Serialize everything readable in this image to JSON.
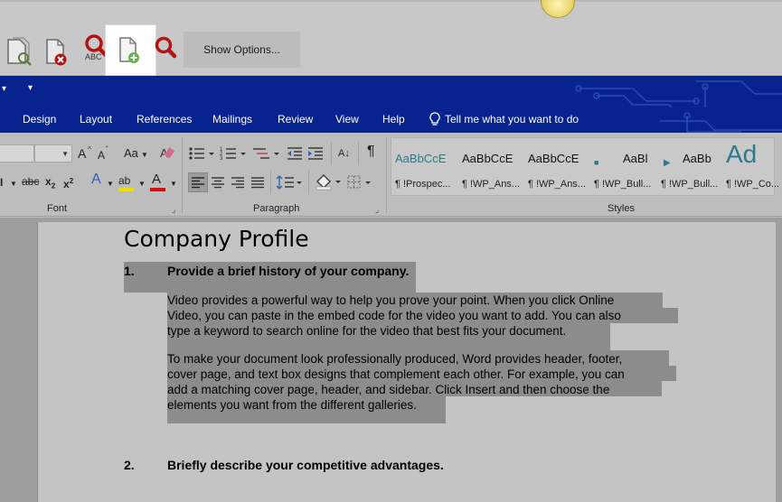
{
  "toolbar": {
    "buttons": [
      {
        "id": "document-search",
        "icon": "document-magnifier-icon"
      },
      {
        "id": "document-remove",
        "icon": "document-remove-icon"
      },
      {
        "id": "spell-search",
        "icon": "magnifier-abc-icon",
        "caption": "ABC"
      },
      {
        "id": "document-add",
        "icon": "document-add-icon",
        "active": true
      },
      {
        "id": "search",
        "icon": "magnifier-icon"
      }
    ],
    "show_options_label": "Show Options..."
  },
  "quick_access": {
    "arrow1": "▾",
    "arrow2": "▾"
  },
  "tabs": [
    "Design",
    "Layout",
    "References",
    "Mailings",
    "Review",
    "View",
    "Help"
  ],
  "tell_me": "Tell me what you want to do",
  "ribbon": {
    "font_group_label": "Font",
    "paragraph_group_label": "Paragraph",
    "styles_group_label": "Styles",
    "case_button": "Aa",
    "font_tools": {
      "grow": "A",
      "shrink": "A",
      "strike": "abc",
      "subscript": "x",
      "superscript": "x",
      "sub_index": "2",
      "sup_index": "2",
      "text_effects": "A",
      "highlight": "ab",
      "font_color": "A",
      "bold_partial": "I"
    },
    "para_tools": {
      "pilcrow": "¶",
      "sort": "A↓"
    },
    "styles": [
      {
        "sample": "AaBbCcE",
        "name": "¶ !Prospec..."
      },
      {
        "sample": "AaBbCcE",
        "name": "¶ !WP_Ans..."
      },
      {
        "sample": "AaBbCcE",
        "name": "¶ !WP_Ans..."
      },
      {
        "sample": "AaBl",
        "name": "¶ !WP_Bull..."
      },
      {
        "sample": "AaBb",
        "name": "¶ !WP_Bull..."
      },
      {
        "sample": "Ad",
        "name": "¶ !WP_Co..."
      }
    ]
  },
  "colors": {
    "accent": "#07238f",
    "highlight_gray": "#8c8c8c",
    "style_teal": "#2a7a8a",
    "icon_red": "#b01515"
  },
  "document": {
    "title": "Company Profile",
    "items": [
      {
        "number": "1.",
        "heading": "Provide a brief history of your company.",
        "paragraphs": [
          [
            "Video provides a powerful way to help you prove your point. When you click Online",
            "Video, you can paste in the embed code for the video you want to add. You can also",
            "type a keyword to search online for the video that best fits your document."
          ],
          [
            "To make your document look professionally produced, Word provides header, footer,",
            "cover page, and text box designs that complement each other. For example, you can",
            "add a matching cover page, header, and sidebar. Click Insert and then choose the",
            "elements you want from the different galleries."
          ]
        ]
      },
      {
        "number": "2.",
        "heading": "Briefly describe your competitive advantages."
      }
    ]
  }
}
